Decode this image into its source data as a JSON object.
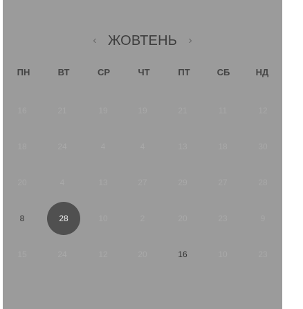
{
  "calendar": {
    "prev_icon": "chevron-left-icon",
    "next_icon": "chevron-right-icon",
    "prev_glyph": "‹",
    "next_glyph": "›",
    "month": "ЖОВТЕНЬ",
    "weekdays": [
      "ПН",
      "ВТ",
      "СР",
      "ЧТ",
      "ПТ",
      "СБ",
      "НД"
    ],
    "rows": [
      [
        {
          "label": "16",
          "state": "muted"
        },
        {
          "label": "21",
          "state": "muted"
        },
        {
          "label": "19",
          "state": "muted"
        },
        {
          "label": "19",
          "state": "muted"
        },
        {
          "label": "21",
          "state": "muted"
        },
        {
          "label": "11",
          "state": "muted"
        },
        {
          "label": "12",
          "state": "muted"
        }
      ],
      [
        {
          "label": "18",
          "state": "muted"
        },
        {
          "label": "24",
          "state": "muted"
        },
        {
          "label": "4",
          "state": "muted"
        },
        {
          "label": "4",
          "state": "muted"
        },
        {
          "label": "13",
          "state": "muted"
        },
        {
          "label": "18",
          "state": "muted"
        },
        {
          "label": "30",
          "state": "muted"
        }
      ],
      [
        {
          "label": "20",
          "state": "muted"
        },
        {
          "label": "4",
          "state": "muted"
        },
        {
          "label": "13",
          "state": "muted"
        },
        {
          "label": "27",
          "state": "muted"
        },
        {
          "label": "29",
          "state": "muted"
        },
        {
          "label": "27",
          "state": "muted"
        },
        {
          "label": "28",
          "state": "muted"
        }
      ],
      [
        {
          "label": "8",
          "state": "active"
        },
        {
          "label": "28",
          "state": "selected"
        },
        {
          "label": "10",
          "state": "muted"
        },
        {
          "label": "2",
          "state": "muted"
        },
        {
          "label": "20",
          "state": "muted"
        },
        {
          "label": "23",
          "state": "muted"
        },
        {
          "label": "9",
          "state": "muted"
        }
      ],
      [
        {
          "label": "15",
          "state": "muted"
        },
        {
          "label": "24",
          "state": "muted"
        },
        {
          "label": "12",
          "state": "muted"
        },
        {
          "label": "20",
          "state": "muted"
        },
        {
          "label": "16",
          "state": "active"
        },
        {
          "label": "10",
          "state": "muted"
        },
        {
          "label": "23",
          "state": "muted"
        }
      ]
    ]
  },
  "colors": {
    "panel_background": "#9b9b9b",
    "selected_background": "#505050",
    "muted_text": "#a9a9a9",
    "active_text": "#333333"
  }
}
